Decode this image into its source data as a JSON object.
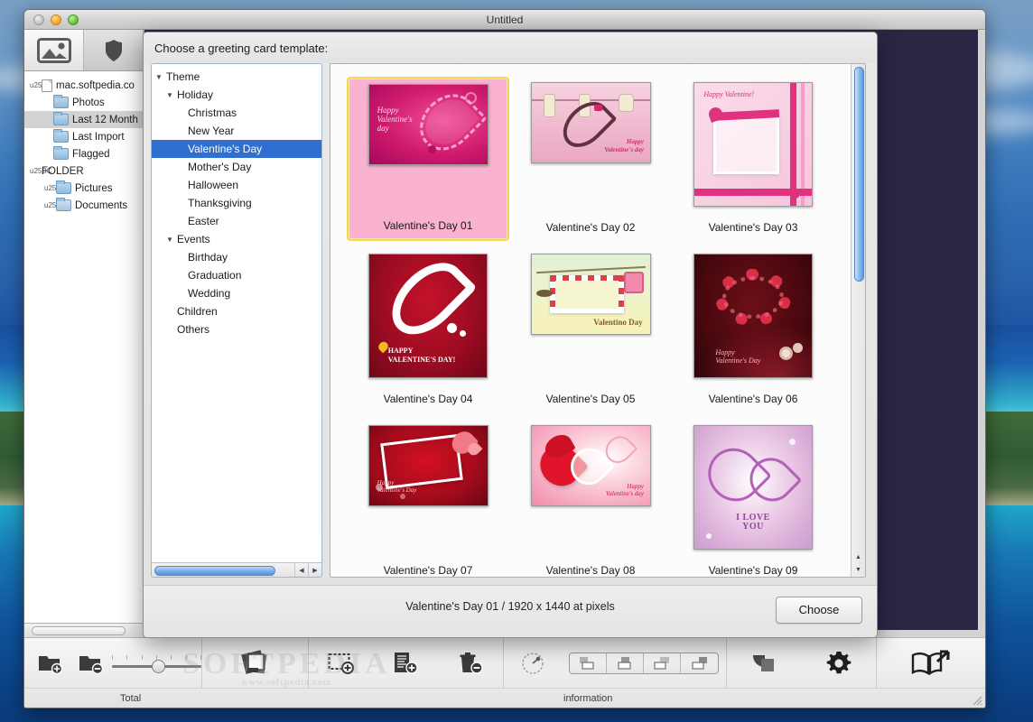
{
  "desktop": {
    "wallpaper": "tropical-island-ocean"
  },
  "window": {
    "title": "Untitled",
    "controls": {
      "close": "close",
      "minimize": "minimize",
      "zoom": "zoom"
    }
  },
  "sidebar": {
    "tabs": [
      {
        "name": "photos-tab",
        "icon": "photo-icon",
        "active": true
      },
      {
        "name": "shapes-tab",
        "icon": "shield-icon",
        "active": false
      }
    ],
    "items": [
      {
        "label": "mac.softpedia.co",
        "icon": "file-icon",
        "indent": 1,
        "twisty": "down",
        "selected": false
      },
      {
        "label": "Photos",
        "icon": "folder-icon",
        "indent": 2,
        "twisty": "",
        "selected": false
      },
      {
        "label": "Last 12 Month",
        "icon": "folder-icon",
        "indent": 2,
        "twisty": "",
        "selected": true
      },
      {
        "label": "Last Import",
        "icon": "folder-icon",
        "indent": 2,
        "twisty": "",
        "selected": false
      },
      {
        "label": "Flagged",
        "icon": "folder-icon",
        "indent": 2,
        "twisty": "",
        "selected": false
      },
      {
        "label": "FOLDER",
        "icon": "",
        "indent": 1,
        "twisty": "down",
        "selected": false
      },
      {
        "label": "Pictures",
        "icon": "folder-icon",
        "indent": 3,
        "twisty": "right",
        "selected": false
      },
      {
        "label": "Documents",
        "icon": "folder-doc-icon",
        "indent": 3,
        "twisty": "right",
        "selected": false
      }
    ]
  },
  "toolbar": {
    "buttons": [
      {
        "name": "add-folder-button",
        "icon": "folder-plus-icon"
      },
      {
        "name": "remove-folder-button",
        "icon": "folder-minus-icon"
      },
      {
        "name": "zoom-slider",
        "icon": "slider"
      },
      {
        "name": "new-project-button",
        "icon": "photos-stack-icon"
      },
      {
        "name": "add-frame-button",
        "icon": "frame-plus-icon"
      },
      {
        "name": "add-page-button",
        "icon": "page-plus-icon"
      },
      {
        "name": "delete-button",
        "icon": "trash-minus-icon"
      },
      {
        "name": "rotate-dial",
        "icon": "rotate-dial-icon"
      },
      {
        "name": "layout-segment-1",
        "icon": "layout-bottom-left-icon"
      },
      {
        "name": "layout-segment-2",
        "icon": "layout-top-center-icon"
      },
      {
        "name": "layout-segment-3",
        "icon": "layout-split-icon"
      },
      {
        "name": "layout-segment-4",
        "icon": "layout-top-right-icon"
      },
      {
        "name": "arrange-button",
        "icon": "layers-icon"
      },
      {
        "name": "settings-button",
        "icon": "gear-icon"
      },
      {
        "name": "share-book-button",
        "icon": "book-share-icon"
      }
    ],
    "status_total": "Total",
    "status_information": "information",
    "watermark": "SOFTPEDIA",
    "watermark_sub": "www.softpedia.com"
  },
  "dialog": {
    "header": "Choose a greeting card template:",
    "tree": [
      {
        "label": "Theme",
        "indent": 1,
        "twisty": "down",
        "selected": false
      },
      {
        "label": "Holiday",
        "indent": 2,
        "twisty": "down",
        "selected": false
      },
      {
        "label": "Christmas",
        "indent": 3,
        "twisty": "",
        "selected": false
      },
      {
        "label": "New Year",
        "indent": 3,
        "twisty": "",
        "selected": false
      },
      {
        "label": "Valentine's Day",
        "indent": 3,
        "twisty": "",
        "selected": true
      },
      {
        "label": "Mother's Day",
        "indent": 3,
        "twisty": "",
        "selected": false
      },
      {
        "label": "Halloween",
        "indent": 3,
        "twisty": "",
        "selected": false
      },
      {
        "label": "Thanksgiving",
        "indent": 3,
        "twisty": "",
        "selected": false
      },
      {
        "label": "Easter",
        "indent": 3,
        "twisty": "",
        "selected": false
      },
      {
        "label": "Events",
        "indent": 2,
        "twisty": "down",
        "selected": false
      },
      {
        "label": "Birthday",
        "indent": 3,
        "twisty": "",
        "selected": false
      },
      {
        "label": "Graduation",
        "indent": 3,
        "twisty": "",
        "selected": false
      },
      {
        "label": "Wedding",
        "indent": 3,
        "twisty": "",
        "selected": false
      },
      {
        "label": "Children",
        "indent": 2,
        "twisty": "",
        "selected": false
      },
      {
        "label": "Others",
        "indent": 2,
        "twisty": "",
        "selected": false
      }
    ],
    "templates": [
      {
        "label": "Valentine's Day 01",
        "art": "a1",
        "selected": true,
        "orient": "landscape"
      },
      {
        "label": "Valentine's Day 02",
        "art": "a2",
        "selected": false,
        "orient": "landscape"
      },
      {
        "label": "Valentine's Day 03",
        "art": "a3",
        "selected": false,
        "orient": "portrait"
      },
      {
        "label": "Valentine's Day 04",
        "art": "a4",
        "selected": false,
        "orient": "portrait"
      },
      {
        "label": "Valentine's Day 05",
        "art": "a5",
        "selected": false,
        "orient": "landscape"
      },
      {
        "label": "Valentine's Day 06",
        "art": "a6",
        "selected": false,
        "orient": "portrait"
      },
      {
        "label": "Valentine's Day 07",
        "art": "a7",
        "selected": false,
        "orient": "landscape"
      },
      {
        "label": "Valentine's Day 08",
        "art": "a8",
        "selected": false,
        "orient": "landscape"
      },
      {
        "label": "Valentine's Day 09",
        "art": "a9",
        "selected": false,
        "orient": "portrait"
      }
    ],
    "status": "Valentine's Day 01 / 1920 x 1440 at pixels",
    "choose_label": "Choose",
    "selection_color": "#f5d74e",
    "selection_fill": "#f9b2cf",
    "tree_selection_color": "#2f6fd0"
  }
}
